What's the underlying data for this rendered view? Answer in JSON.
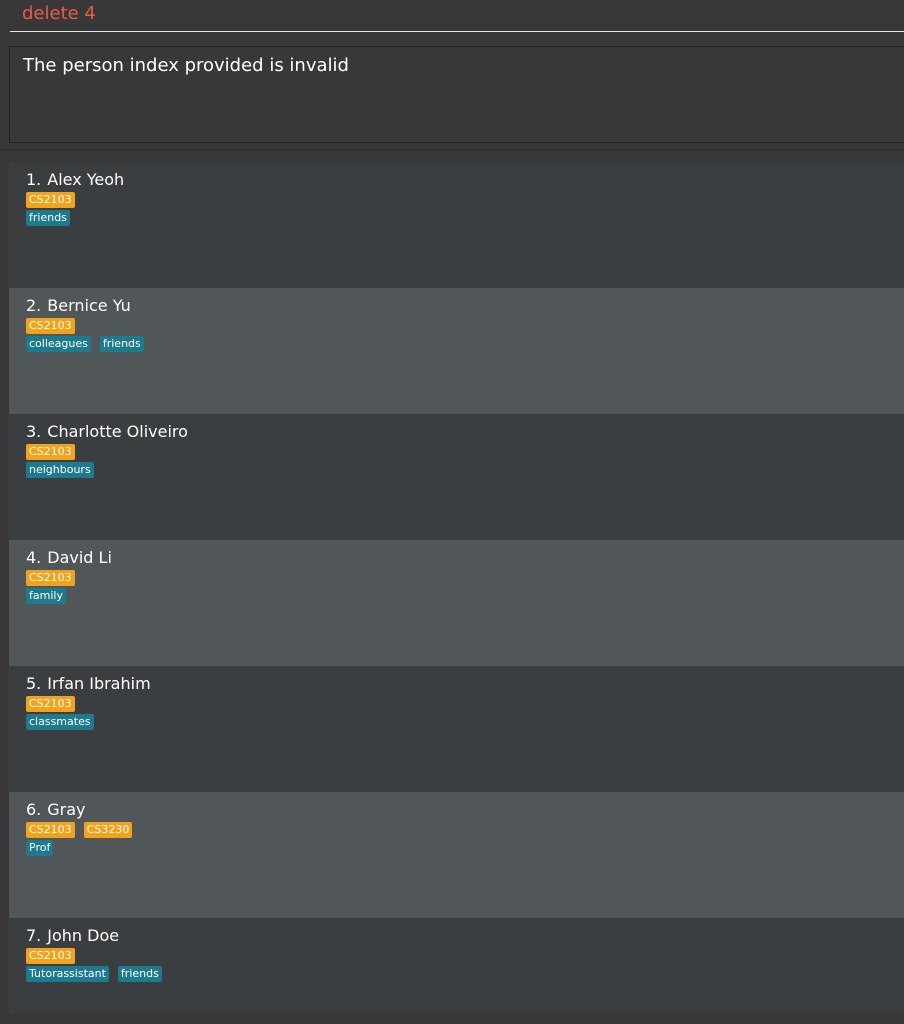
{
  "command": {
    "value": "delete 4"
  },
  "result": {
    "message": "The person index provided is invalid"
  },
  "persons": [
    {
      "index": "1.",
      "name": "Alex Yeoh",
      "courses": [
        "CS2103"
      ],
      "tags": [
        "friends"
      ]
    },
    {
      "index": "2.",
      "name": "Bernice Yu",
      "courses": [
        "CS2103"
      ],
      "tags": [
        "colleagues",
        "friends"
      ]
    },
    {
      "index": "3.",
      "name": "Charlotte Oliveiro",
      "courses": [
        "CS2103"
      ],
      "tags": [
        "neighbours"
      ]
    },
    {
      "index": "4.",
      "name": "David Li",
      "courses": [
        "CS2103"
      ],
      "tags": [
        "family"
      ]
    },
    {
      "index": "5.",
      "name": "Irfan Ibrahim",
      "courses": [
        "CS2103"
      ],
      "tags": [
        "classmates"
      ]
    },
    {
      "index": "6.",
      "name": "Gray",
      "courses": [
        "CS2103",
        "CS3230"
      ],
      "tags": [
        "Prof"
      ]
    },
    {
      "index": "7.",
      "name": "John Doe",
      "courses": [
        "CS2103"
      ],
      "tags": [
        "Tutorassistant",
        "friends"
      ]
    }
  ],
  "colors": {
    "command_text": "#e85c46",
    "course_tag": "#f2a31b",
    "tag": "#1e7a8f",
    "card_odd": "#3b3e40",
    "card_even": "#515658"
  }
}
